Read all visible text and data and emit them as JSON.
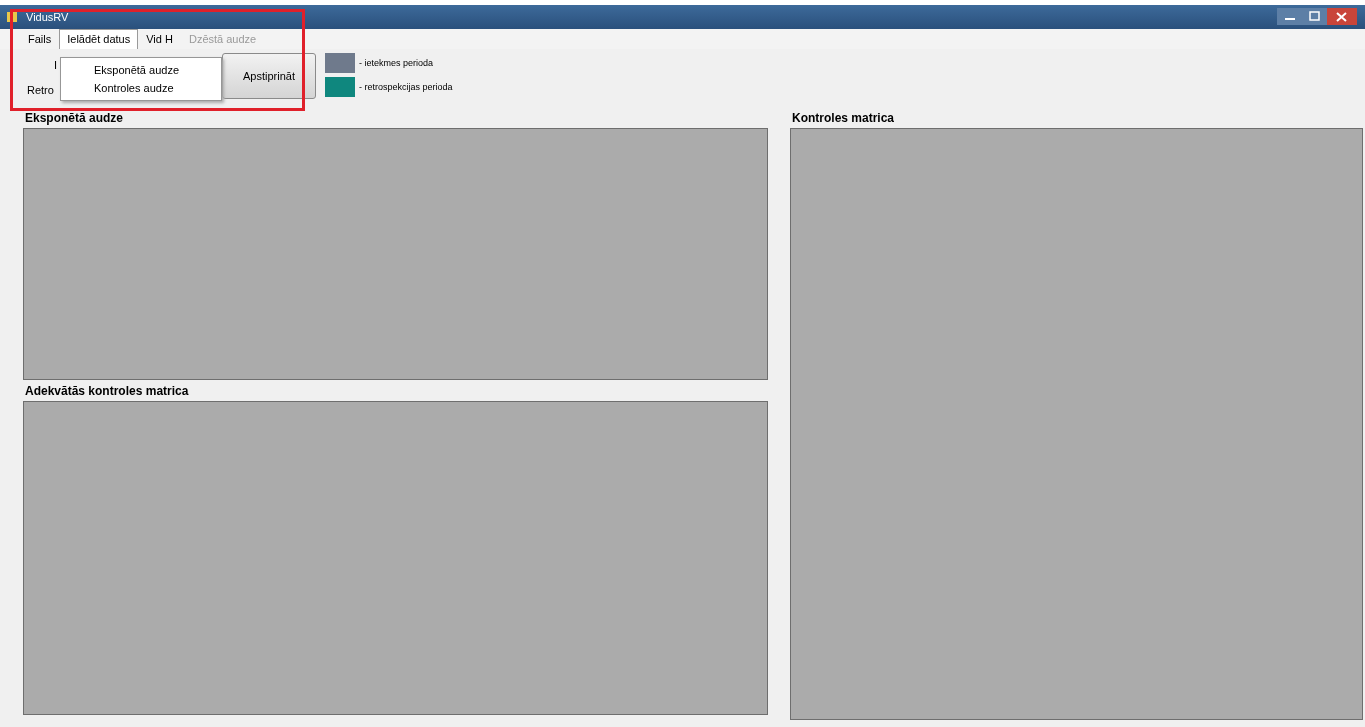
{
  "window": {
    "title": "VidusRV"
  },
  "menu": [
    {
      "label": "Fails",
      "open": false,
      "disabled": false
    },
    {
      "label": "Ielādēt datus",
      "open": true,
      "disabled": false
    },
    {
      "label": "Vid H",
      "open": false,
      "disabled": false
    },
    {
      "label": "Dzēstā audze",
      "open": false,
      "disabled": true
    }
  ],
  "dropdown": [
    "Eksponētā audze",
    "Kontroles audze"
  ],
  "toolbar": {
    "label_1": "I",
    "label_2": "Retro",
    "button": "Apstiprināt"
  },
  "legend": [
    {
      "color": "#6f7a8c",
      "label": "- ietekmes perioda"
    },
    {
      "color": "#0f877e",
      "label": "- retrospekcijas perioda"
    }
  ],
  "panels": {
    "top_left": "Eksponētā audze",
    "bottom_left": "Adekvātās kontroles matrica",
    "right": "Kontroles matrica"
  }
}
